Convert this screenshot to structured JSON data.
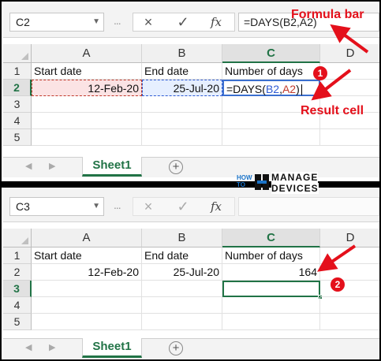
{
  "top": {
    "namebox": "C2",
    "formula": "=DAYS(B2,A2)",
    "formula_bar_label": "Formula bar",
    "result_cell_label": "Result cell",
    "badge": "1",
    "columns": [
      "A",
      "B",
      "C",
      "D"
    ],
    "rows": [
      "1",
      "2",
      "3",
      "4",
      "5"
    ],
    "cells": {
      "a1": "Start date",
      "b1": "End date",
      "c1": "Number of days",
      "a2": "12-Feb-20",
      "b2": "25-Jul-20",
      "c2_prefix": "=DAYS(",
      "c2_ref_b": "B2",
      "c2_comma": ",",
      "c2_ref_a": "A2",
      "c2_suffix": ")"
    },
    "sheet_tab": "Sheet1",
    "add_sheet": "+"
  },
  "bottom": {
    "namebox": "C3",
    "formula": "",
    "badge": "2",
    "columns": [
      "A",
      "B",
      "C",
      "D"
    ],
    "rows": [
      "1",
      "2",
      "3",
      "4",
      "5"
    ],
    "cells": {
      "a1": "Start date",
      "b1": "End date",
      "c1": "Number of days",
      "a2": "12-Feb-20",
      "b2": "25-Jul-20",
      "c2": "164"
    },
    "sheet_tab": "Sheet1",
    "add_sheet": "+"
  },
  "logo": {
    "line1": "HOW",
    "line2": "TO",
    "line3": "MANAGE",
    "line4": "DEVICES"
  },
  "icons": {
    "cancel": "×",
    "enter": "✓",
    "fx": "fx",
    "dropdown": "▼",
    "nav_left": "◀",
    "nav_right": "▶",
    "dots": "..."
  },
  "colors": {
    "accent": "#217346",
    "annotation": "#e4101b",
    "ref_b": "#2f5bd3",
    "ref_a": "#c0392b"
  }
}
